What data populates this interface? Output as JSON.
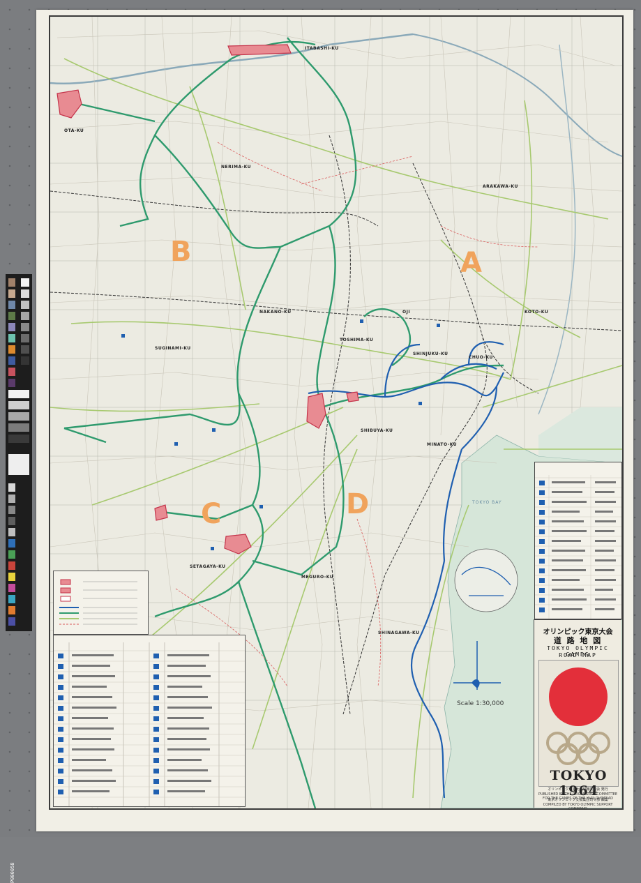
{
  "map": {
    "zones": [
      "A",
      "B",
      "C",
      "D"
    ],
    "places": [
      "OJI",
      "ITABASHI-KU",
      "OTA-KU",
      "NERIMA-KU",
      "TOSHIMA-KU",
      "SHINJUKU-KU",
      "NAKANO-KU",
      "SUGINAMI-KU",
      "SETAGAYA-KU",
      "SHIBUYA-KU",
      "MINATO-KU",
      "CHUO-KU",
      "KOTO-KU",
      "ARAKAWA-KU",
      "SHINAGAWA-KU",
      "MEGURO-KU"
    ],
    "bay_name": "TOKYO BAY",
    "scale": "Scale 1:30,000",
    "colors": {
      "olympic_route": "#2e9a6d",
      "expressway": "#1f5fb0",
      "major_road": "#9fc46a",
      "venue": "#e0616e",
      "water": "#d7e6dc"
    }
  },
  "color_target": {
    "number": "P000058"
  },
  "cover": {
    "title_jp_1": "オリンピック東京大会",
    "title_jp_2": "道 路 地 図",
    "title_en_1": "TOKYO OLYMPIC GAMES",
    "title_en_2": "ROAD MAP",
    "year": "TOKYO 1964",
    "publisher_jp_1": "オリンピック東京大会組織委員会 発行",
    "publisher_en_1": "PUBLISHED BY THE ORGANIZING COMMITTEE FOR THE GAMES OF THE XVIII OLYMPIAD",
    "publisher_jp_2": "東京オリンピック支援集団司令部 編集",
    "publisher_en_2": "COMPILED BY TOKYO OLYMPIC SUPPORT COMMAND"
  }
}
